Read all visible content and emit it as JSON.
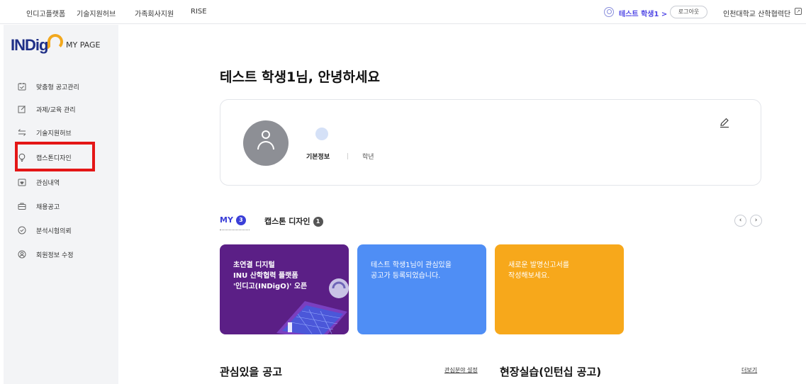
{
  "topbar": {
    "nav": [
      "인디고플랫폼",
      "기술지원허브",
      "가족회사지원",
      "RISE"
    ],
    "user_name": "테스트 학생1 >",
    "logout_label": "로그아웃",
    "org_link": "인천대학교 산학협력단"
  },
  "sidebar": {
    "logo_text": "INDig",
    "mypage_label": "MY PAGE",
    "items": [
      {
        "label": "맞춤형 공고관리",
        "icon": "calendar-check-icon"
      },
      {
        "label": "과제/교육 관리",
        "icon": "edit-square-icon"
      },
      {
        "label": "기술지원허브",
        "icon": "swap-arrows-icon"
      },
      {
        "label": "캡스톤디자인",
        "icon": "lightbulb-icon",
        "active": true
      },
      {
        "label": "관심내역",
        "icon": "calendar-heart-icon"
      },
      {
        "label": "채용공고",
        "icon": "briefcase-icon"
      },
      {
        "label": "분석시험의뢰",
        "icon": "shield-check-icon"
      },
      {
        "label": "회원정보 수정",
        "icon": "user-circle-icon"
      }
    ]
  },
  "main": {
    "greeting": "테스트 학생1님, 안녕하세요",
    "profile": {
      "basic_info_label": "기본정보",
      "grade_label": "학년"
    },
    "tabs": [
      {
        "label": "MY",
        "count": "3",
        "active": true
      },
      {
        "label": "캡스톤 디자인",
        "count": "1",
        "active": false
      }
    ],
    "cards": [
      {
        "text": "초연결 디지털\nINU 산학협력 플랫폼\n'인디고(INDigO)' 오픈",
        "color": "#5b1f86"
      },
      {
        "text": "테스트 학생1님이 관심있을\n공고가 등록되었습니다.",
        "color": "#4f8ef5"
      },
      {
        "text": "새로운 발명신고서를\n작성해보세요.",
        "color": "#f7a81b"
      }
    ],
    "sections": [
      {
        "title": "관심있을 공고",
        "link": "관심분야 설정"
      },
      {
        "title": "현장실습(인턴십 공고)",
        "link": "더보기"
      }
    ]
  },
  "colors": {
    "accent": "#3b3fd8",
    "sidebar_bg": "#f3f4f6",
    "highlight_box": "#e41616"
  }
}
